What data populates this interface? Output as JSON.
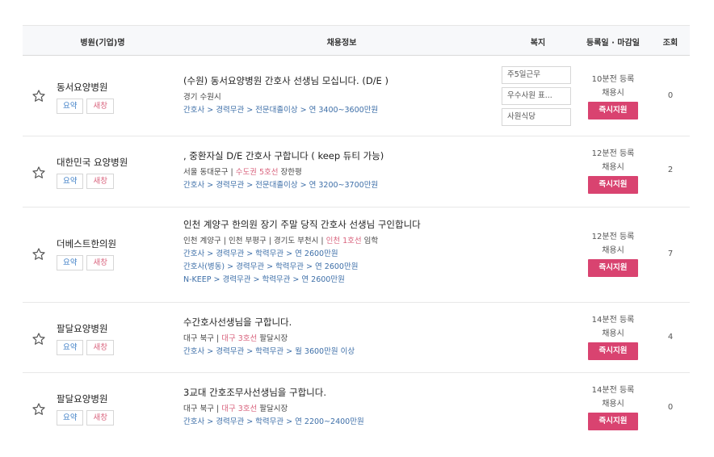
{
  "header": {
    "company": "병원(기업)명",
    "info": "채용정보",
    "welfare": "복지",
    "date": "등록일 · 마감일",
    "views": "조회"
  },
  "tags": {
    "summary": "요약",
    "scrap": "새창"
  },
  "rows": [
    {
      "company": "동서요양병원",
      "title": "(수원) 동서요양병원 간호사 선생님 모십니다. (D/E )",
      "loc_pre": "경기 수원시",
      "loc_station": "",
      "loc_post": "",
      "conditions": [
        "간호사 > 경력무관 > 전문대졸이상 > 연 3400~3600만원"
      ],
      "welfare": [
        "주5일근무",
        "우수사원 표...",
        "사원식당"
      ],
      "registered": "10분전 등록",
      "deadline": "채용시",
      "apply": "즉시지원",
      "views": "0"
    },
    {
      "company": "대한민국 요양병원",
      "title": ", 중환자실 D/E 간호사 구합니다 ( keep 듀티 가능)",
      "loc_pre": "서울 동대문구 | ",
      "loc_station": "수도권 5호선",
      "loc_post": " 장한평",
      "conditions": [
        "간호사 > 경력무관 > 전문대졸이상 > 연 3200~3700만원"
      ],
      "welfare": [],
      "registered": "12분전 등록",
      "deadline": "채용시",
      "apply": "즉시지원",
      "views": "2"
    },
    {
      "company": "더베스트한의원",
      "title": "인천 계양구 한의원 장기 주말 당직 간호사 선생님 구인합니다",
      "loc_pre": "인천 계양구 | 인천 부평구 | 경기도 부천시 | ",
      "loc_station": "인천 1호선",
      "loc_post": " 임학",
      "conditions": [
        "간호사 > 경력무관 > 학력무관 > 연 2600만원",
        "간호사(병동) > 경력무관 > 학력무관 > 연 2600만원",
        "N-KEEP > 경력무관 > 학력무관 > 연 2600만원"
      ],
      "welfare": [],
      "registered": "12분전 등록",
      "deadline": "채용시",
      "apply": "즉시지원",
      "views": "7"
    },
    {
      "company": "팔달요양병원",
      "title": "수간호사선생님을 구합니다.",
      "loc_pre": "대구 북구 | ",
      "loc_station": "대구 3호선",
      "loc_post": " 팔달시장",
      "conditions": [
        "간호사 > 경력무관 > 학력무관 > 월 3600만원 이상"
      ],
      "welfare": [],
      "registered": "14분전 등록",
      "deadline": "채용시",
      "apply": "즉시지원",
      "views": "4"
    },
    {
      "company": "팔달요양병원",
      "title": "3교대 간호조무사선생님을 구합니다.",
      "loc_pre": "대구 북구 | ",
      "loc_station": "대구 3호선",
      "loc_post": " 팔달시장",
      "conditions": [
        "간호사 > 경력무관 > 학력무관 > 연 2200~2400만원"
      ],
      "welfare": [],
      "registered": "14분전 등록",
      "deadline": "채용시",
      "apply": "즉시지원",
      "views": "0"
    }
  ],
  "icons": {
    "favorite": "star-outline-icon"
  },
  "colors": {
    "apply_button": "#d94370",
    "station": "#d9647e",
    "condition": "#3e6fa8",
    "summary_tag": "#3d7ec6"
  }
}
